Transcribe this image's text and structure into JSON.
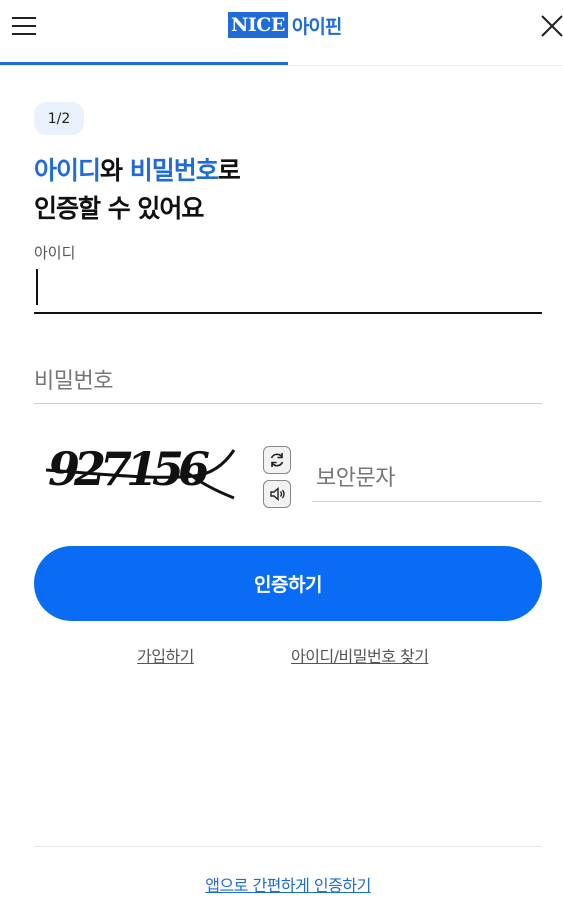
{
  "header": {
    "logo_nice": "NICE",
    "logo_ipin": "아이핀",
    "accent_color": "#1f6bd8",
    "progress_fraction": 0.5
  },
  "step": {
    "label": "1/2"
  },
  "title": {
    "hl1": "아이디",
    "mid1": "와 ",
    "hl2": "비밀번호",
    "mid2": "로",
    "line2": "인증할 수 있어요"
  },
  "form": {
    "id_label": "아이디",
    "id_value": "",
    "password_placeholder": "비밀번호",
    "captcha_text": "927156",
    "captcha_placeholder": "보안문자",
    "submit_label": "인증하기",
    "submit_color": "#0a6cf5"
  },
  "links": {
    "signup": "가입하기",
    "find": "아이디/비밀번호 찾기",
    "app_auth": "앱으로 간편하게 인증하기"
  },
  "icons": {
    "menu": "hamburger-icon",
    "close": "close-icon",
    "refresh": "refresh-icon",
    "sound": "speaker-icon"
  }
}
